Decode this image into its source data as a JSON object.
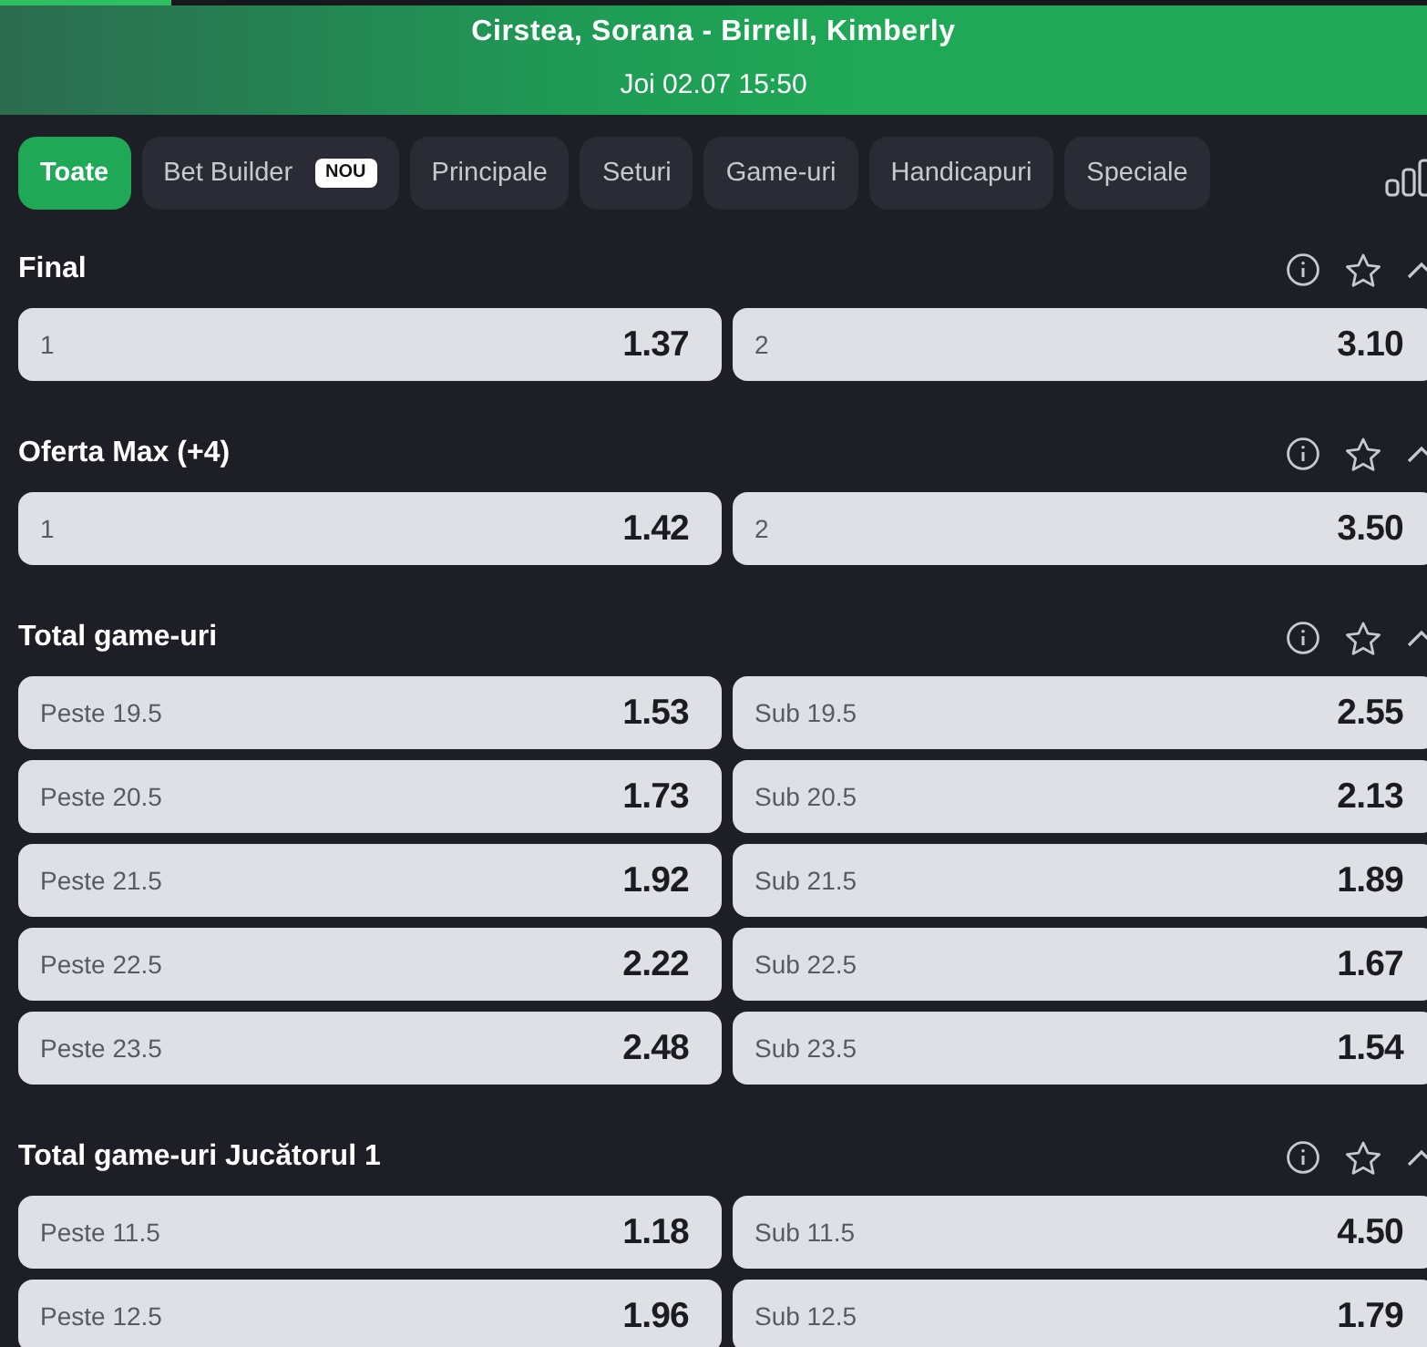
{
  "progress": {
    "level": 0.12
  },
  "header": {
    "title": "Cirstea, Sorana - Birrell, Kimberly",
    "date": "Joi 02.07 15:50"
  },
  "tabs": [
    {
      "label": "Toate",
      "selected": true
    },
    {
      "label": "Bet Builder",
      "badge": "NOU",
      "selected": false
    },
    {
      "label": "Principale",
      "selected": false
    },
    {
      "label": "Seturi",
      "selected": false
    },
    {
      "label": "Game-uri",
      "selected": false
    },
    {
      "label": "Handicapuri",
      "selected": false
    },
    {
      "label": "Speciale",
      "selected": false
    }
  ],
  "markets": [
    {
      "title": "Final",
      "favorite": false,
      "expanded": true,
      "rows": [
        [
          {
            "label": "1",
            "odds": "1.37"
          },
          {
            "label": "2",
            "odds": "3.10"
          }
        ]
      ]
    },
    {
      "title": "Oferta Max (+4)",
      "favorite": false,
      "expanded": true,
      "rows": [
        [
          {
            "label": "1",
            "odds": "1.42"
          },
          {
            "label": "2",
            "odds": "3.50"
          }
        ]
      ]
    },
    {
      "title": "Total game-uri",
      "favorite": false,
      "expanded": true,
      "rows": [
        [
          {
            "label": "Peste 19.5",
            "odds": "1.53"
          },
          {
            "label": "Sub 19.5",
            "odds": "2.55"
          }
        ],
        [
          {
            "label": "Peste 20.5",
            "odds": "1.73"
          },
          {
            "label": "Sub 20.5",
            "odds": "2.13"
          }
        ],
        [
          {
            "label": "Peste 21.5",
            "odds": "1.92"
          },
          {
            "label": "Sub 21.5",
            "odds": "1.89"
          }
        ],
        [
          {
            "label": "Peste 22.5",
            "odds": "2.22"
          },
          {
            "label": "Sub 22.5",
            "odds": "1.67"
          }
        ],
        [
          {
            "label": "Peste 23.5",
            "odds": "2.48"
          },
          {
            "label": "Sub 23.5",
            "odds": "1.54"
          }
        ]
      ]
    },
    {
      "title": "Total game-uri Jucătorul 1",
      "favorite": false,
      "expanded": true,
      "rows": [
        [
          {
            "label": "Peste 11.5",
            "odds": "1.18"
          },
          {
            "label": "Sub 11.5",
            "odds": "4.50"
          }
        ],
        [
          {
            "label": "Peste 12.5",
            "odds": "1.96"
          },
          {
            "label": "Sub 12.5",
            "odds": "1.79"
          }
        ]
      ]
    }
  ]
}
